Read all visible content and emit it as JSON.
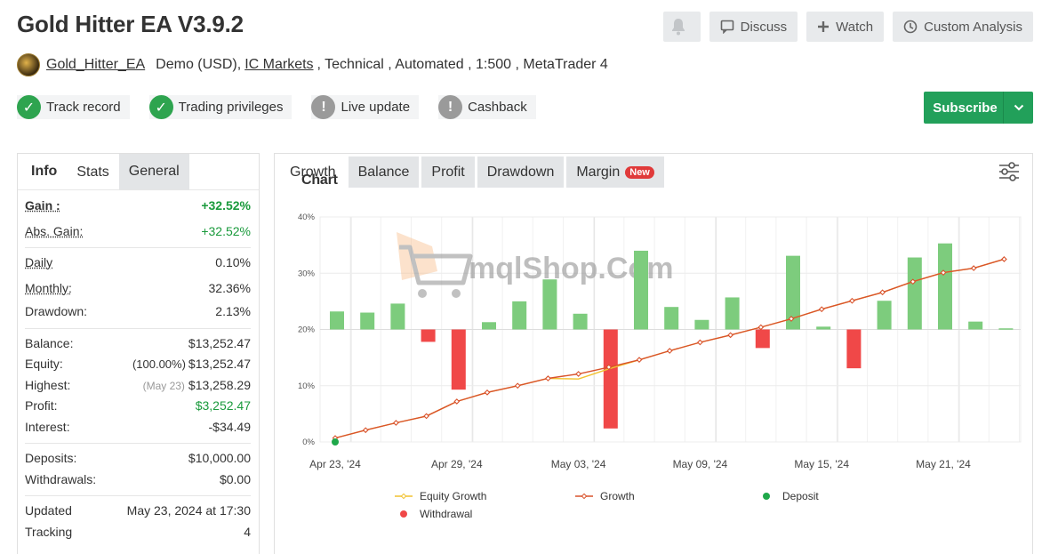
{
  "header": {
    "title": "Gold Hitter EA V3.9.2",
    "discuss_label": "Discuss",
    "watch_label": "Watch",
    "custom_analysis_label": "Custom Analysis",
    "subscribe_label": "Subscribe"
  },
  "account": {
    "author": "Gold_Hitter_EA",
    "account_type": "Demo (USD),",
    "broker": "IC Markets",
    "details": ", Technical , Automated , 1:500 , MetaTrader 4"
  },
  "badges": [
    {
      "label": "Track record",
      "status": "ok"
    },
    {
      "label": "Trading privileges",
      "status": "ok"
    },
    {
      "label": "Live update",
      "status": "no"
    },
    {
      "label": "Cashback",
      "status": "no"
    }
  ],
  "left_tabs": [
    "Info",
    "Stats",
    "General"
  ],
  "stats": {
    "gain_label": "Gain :",
    "gain": "+32.52%",
    "abs_gain_label": "Abs. Gain:",
    "abs_gain": "+32.52%",
    "daily_label": "Daily",
    "daily": "0.10%",
    "monthly_label": "Monthly:",
    "monthly": "32.36%",
    "drawdown_label": "Drawdown:",
    "drawdown": "2.13%",
    "balance_label": "Balance:",
    "balance": "$13,252.47",
    "equity_label": "Equity:",
    "equity_pct": "(100.00%)",
    "equity": "$13,252.47",
    "highest_label": "Highest:",
    "highest_date": "(May 23)",
    "highest": "$13,258.29",
    "profit_label": "Profit:",
    "profit": "$3,252.47",
    "interest_label": "Interest:",
    "interest": "-$34.49",
    "deposits_label": "Deposits:",
    "deposits": "$10,000.00",
    "withdrawals_label": "Withdrawals:",
    "withdrawals": "$0.00",
    "updated_label": "Updated",
    "updated": "May 23, 2024 at 17:30",
    "tracking_label": "Tracking",
    "tracking": "4"
  },
  "chart_tabs": {
    "title": "Chart",
    "tabs": [
      "Growth",
      "Balance",
      "Profit",
      "Drawdown",
      "Margin"
    ],
    "new_badge": "New"
  },
  "watermark": "mqlShop.Com",
  "colors": {
    "accent_green": "#22a05a",
    "bar_positive": "#7dcc7d",
    "bar_negative": "#f04848",
    "growth_line": "#d9532c",
    "equity_line": "#f2c230",
    "deposit_dot": "#1fa84a"
  },
  "chart_data": {
    "type": "bar",
    "x_ticks": [
      "Apr 23, '24",
      "Apr 29, '24",
      "May 03, '24",
      "May 09, '24",
      "May 15, '24",
      "May 21, '24"
    ],
    "ylim": [
      0,
      40
    ],
    "y_ticks": [
      "0%",
      "10%",
      "20%",
      "30%",
      "40%"
    ],
    "grid": true,
    "legend": [
      "Equity Growth",
      "Growth",
      "Deposit",
      "Withdrawal"
    ],
    "legend_position": "bottom",
    "daily_bars": [
      {
        "x": 0,
        "value": 3.2
      },
      {
        "x": 1,
        "value": 3.0
      },
      {
        "x": 2,
        "value": 4.6
      },
      {
        "x": 3,
        "value": -2.2
      },
      {
        "x": 4,
        "value": -10.7
      },
      {
        "x": 5,
        "value": 1.3
      },
      {
        "x": 6,
        "value": 5.0
      },
      {
        "x": 7,
        "value": 8.9
      },
      {
        "x": 8,
        "value": 2.8
      },
      {
        "x": 9,
        "value": -17.6
      },
      {
        "x": 10,
        "value": 14.0
      },
      {
        "x": 11,
        "value": 4.0
      },
      {
        "x": 12,
        "value": 1.7
      },
      {
        "x": 13,
        "value": 5.7
      },
      {
        "x": 14,
        "value": -3.3
      },
      {
        "x": 15,
        "value": 13.1
      },
      {
        "x": 16,
        "value": 0.5
      },
      {
        "x": 17,
        "value": -6.9
      },
      {
        "x": 18,
        "value": 5.1
      },
      {
        "x": 19,
        "value": 12.8
      },
      {
        "x": 20,
        "value": 15.3
      },
      {
        "x": 21,
        "value": 1.4
      },
      {
        "x": 22,
        "value": 0.2
      }
    ],
    "growth": [
      {
        "x": 0,
        "value": 0.7
      },
      {
        "x": 1,
        "value": 2.1
      },
      {
        "x": 2,
        "value": 3.4
      },
      {
        "x": 3,
        "value": 4.6
      },
      {
        "x": 4,
        "value": 7.2
      },
      {
        "x": 5,
        "value": 8.8
      },
      {
        "x": 6,
        "value": 10.0
      },
      {
        "x": 7,
        "value": 11.3
      },
      {
        "x": 8,
        "value": 12.1
      },
      {
        "x": 9,
        "value": 13.3
      },
      {
        "x": 10,
        "value": 14.6
      },
      {
        "x": 11,
        "value": 16.2
      },
      {
        "x": 12,
        "value": 17.7
      },
      {
        "x": 13,
        "value": 19.0
      },
      {
        "x": 14,
        "value": 20.4
      },
      {
        "x": 15,
        "value": 21.9
      },
      {
        "x": 16,
        "value": 23.6
      },
      {
        "x": 17,
        "value": 25.1
      },
      {
        "x": 18,
        "value": 26.6
      },
      {
        "x": 19,
        "value": 28.5
      },
      {
        "x": 20,
        "value": 30.1
      },
      {
        "x": 21,
        "value": 30.9
      },
      {
        "x": 22,
        "value": 32.5
      }
    ],
    "equity_growth": [
      {
        "x": 0,
        "value": 0.7
      },
      {
        "x": 1,
        "value": 2.1
      },
      {
        "x": 2,
        "value": 3.4
      },
      {
        "x": 3,
        "value": 4.6
      },
      {
        "x": 4,
        "value": 7.2
      },
      {
        "x": 5,
        "value": 8.8
      },
      {
        "x": 6,
        "value": 10.0
      },
      {
        "x": 7,
        "value": 11.3
      },
      {
        "x": 8,
        "value": 11.2
      },
      {
        "x": 9,
        "value": 13.0
      },
      {
        "x": 10,
        "value": 14.6
      },
      {
        "x": 11,
        "value": 16.2
      },
      {
        "x": 12,
        "value": 17.7
      },
      {
        "x": 13,
        "value": 19.0
      },
      {
        "x": 14,
        "value": 20.4
      },
      {
        "x": 15,
        "value": 21.9
      },
      {
        "x": 16,
        "value": 23.6
      },
      {
        "x": 17,
        "value": 25.1
      },
      {
        "x": 18,
        "value": 26.6
      },
      {
        "x": 19,
        "value": 28.5
      },
      {
        "x": 20,
        "value": 30.1
      },
      {
        "x": 21,
        "value": 30.9
      },
      {
        "x": 22,
        "value": 32.5
      }
    ],
    "deposit": [
      {
        "x": 0,
        "value": 0
      }
    ]
  }
}
